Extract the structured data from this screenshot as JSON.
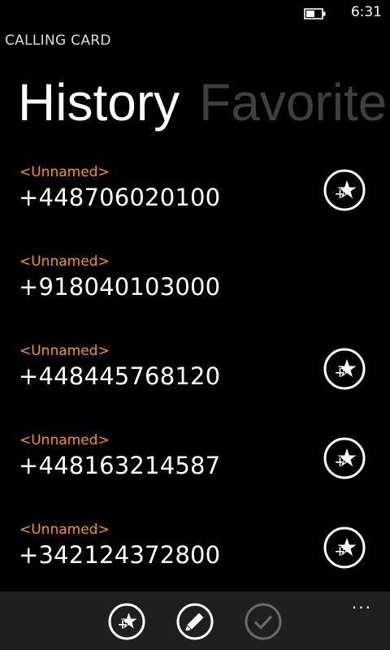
{
  "status": {
    "time": "6:31",
    "battery_icon": "battery-icon"
  },
  "app": {
    "title": "CALLING CARD"
  },
  "pivot": {
    "active": "History",
    "inactive": "Favorite"
  },
  "history": [
    {
      "name": "<Unnamed>",
      "phone": "+448706020100",
      "favorite_button": true
    },
    {
      "name": "<Unnamed>",
      "phone": "+918040103000",
      "favorite_button": false
    },
    {
      "name": "<Unnamed>",
      "phone": "+448445768120",
      "favorite_button": true
    },
    {
      "name": "<Unnamed>",
      "phone": "+448163214587",
      "favorite_button": true
    },
    {
      "name": "<Unnamed>",
      "phone": "+342124372800",
      "favorite_button": true
    }
  ],
  "appbar": {
    "buttons": [
      "add-favorite-icon",
      "edit-icon",
      "check-icon"
    ],
    "more": "..."
  },
  "colors": {
    "accent": "#f0961e",
    "inactive_pivot": "#3f3f3f",
    "appbar_bg": "#1f1f1f"
  }
}
